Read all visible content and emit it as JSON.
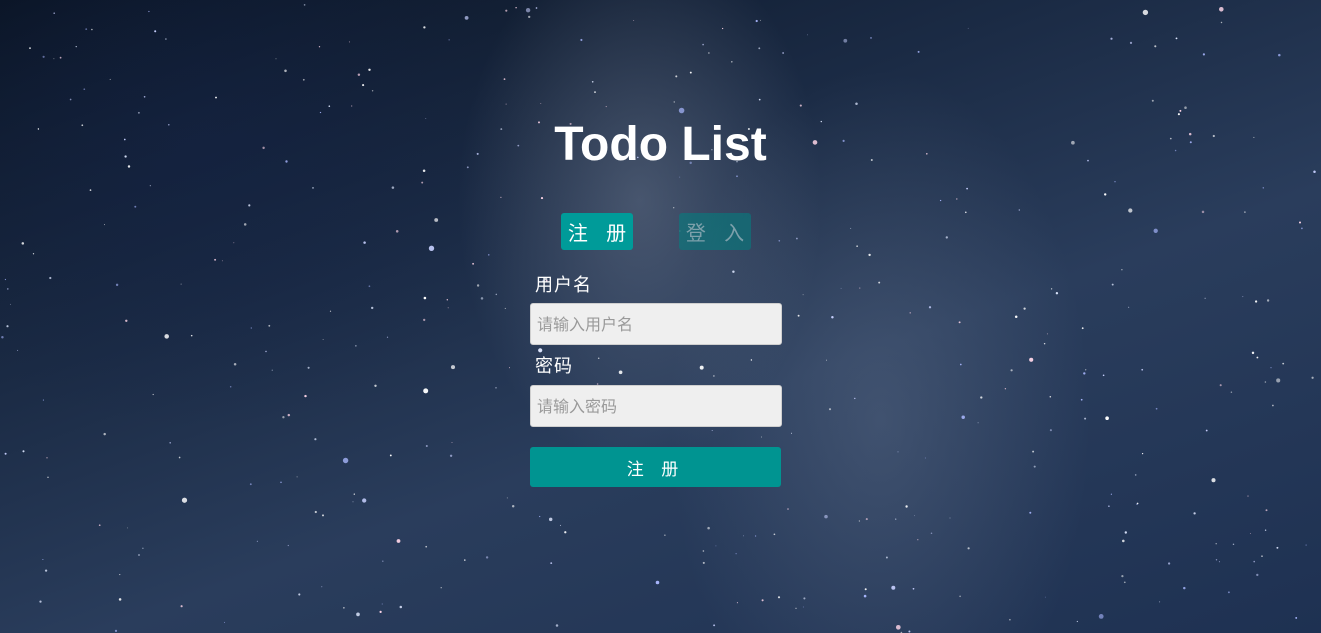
{
  "app": {
    "title": "Todo List"
  },
  "tabs": [
    {
      "label": "注 册",
      "active": true
    },
    {
      "label": "登 入",
      "active": false
    }
  ],
  "form": {
    "username": {
      "label": "用户名",
      "placeholder": "请输入用户名",
      "value": ""
    },
    "password": {
      "label": "密码",
      "placeholder": "请输入密码",
      "value": ""
    },
    "submit_label": "注 册"
  },
  "colors": {
    "accent": "#009b99",
    "submit": "#009491",
    "inactive_tab": "#00827f",
    "input_bg": "#efefef",
    "text": "#ffffff"
  }
}
